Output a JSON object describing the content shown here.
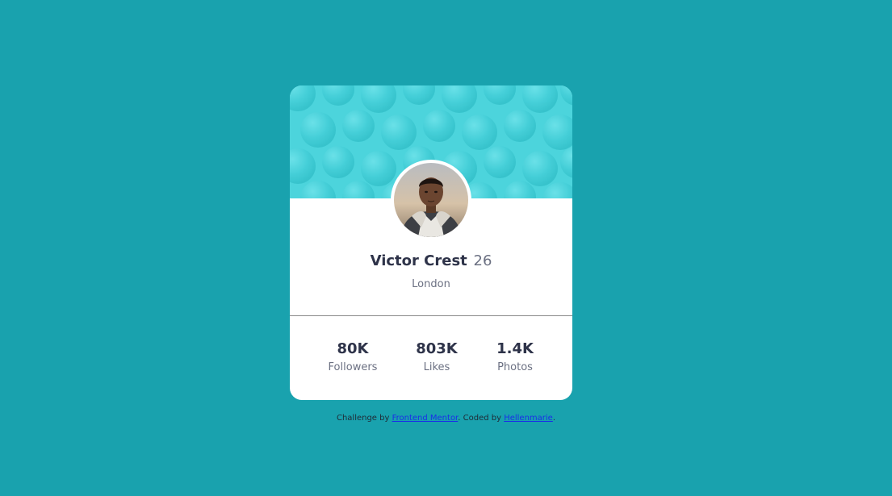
{
  "colors": {
    "page_background": "#19a2ae",
    "card_background": "#ffffff",
    "header_pattern": "#4cd4dc",
    "text_dark": "#2e3349",
    "text_muted": "#6b7082",
    "link": "#1a2fe8"
  },
  "profile": {
    "name": "Victor Crest",
    "age": "26",
    "location": "London",
    "avatar_icon": "person-photo"
  },
  "stats": [
    {
      "value": "80K",
      "label": "Followers"
    },
    {
      "value": "803K",
      "label": "Likes"
    },
    {
      "value": "1.4K",
      "label": "Photos"
    }
  ],
  "attribution": {
    "prefix": "Challenge by ",
    "link1_text": "Frontend Mentor",
    "middle": ". Coded by ",
    "link2_text": "Hellenmarie",
    "suffix": "."
  }
}
